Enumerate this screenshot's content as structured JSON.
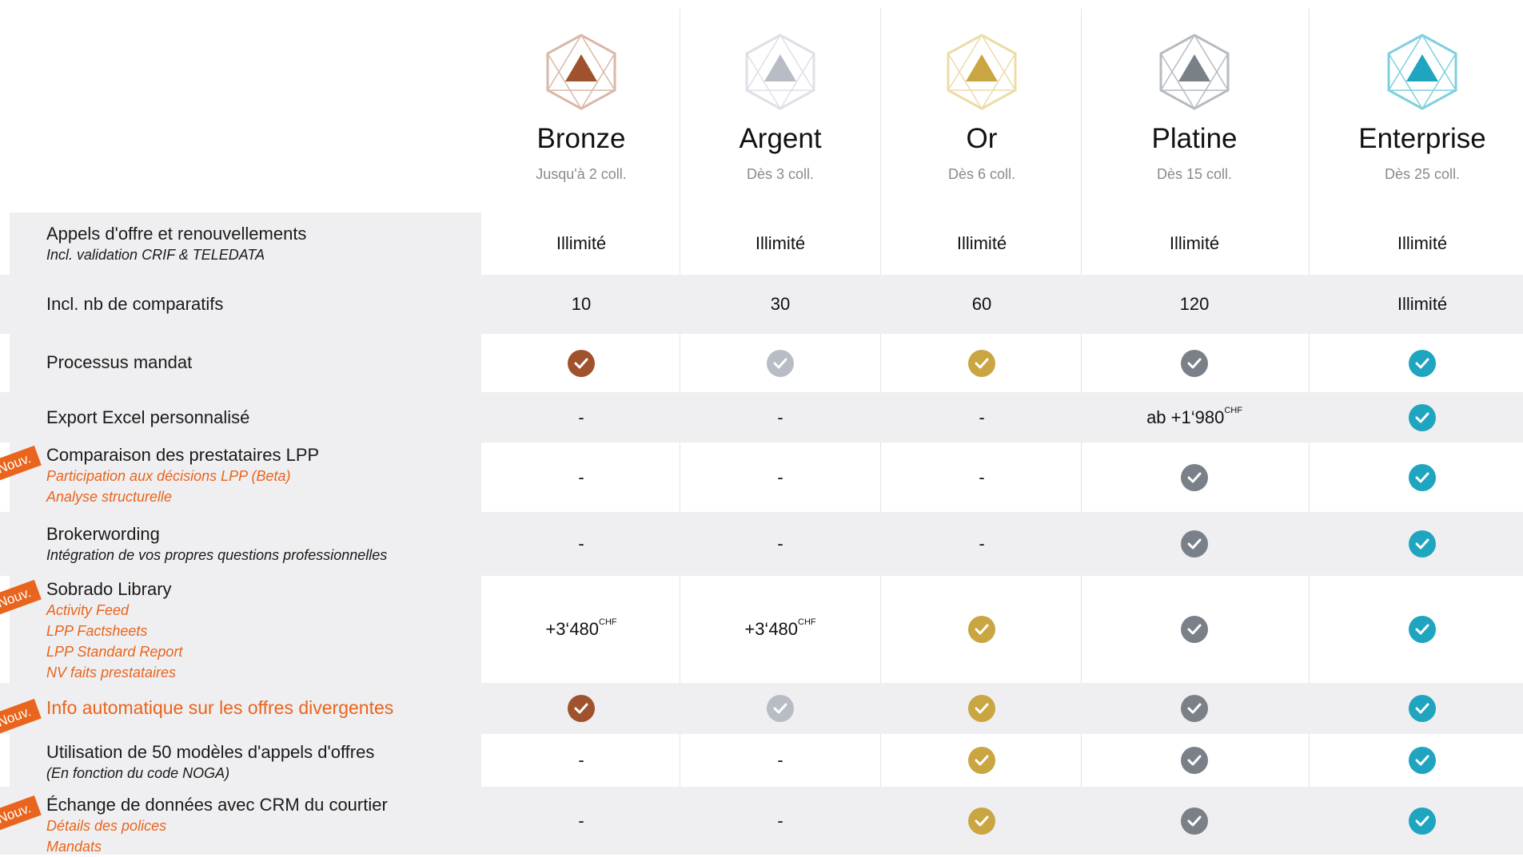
{
  "colors": {
    "bronze": "#a0522d",
    "argent": "#b8bcc4",
    "or": "#c9a642",
    "platine": "#7a8088",
    "enterprise": "#1fa5bf",
    "orange_accent": "#e9641c"
  },
  "tiers": [
    {
      "name": "Bronze",
      "subtitle": "Jusqu'à 2 coll."
    },
    {
      "name": "Argent",
      "subtitle": "Dès 3 coll."
    },
    {
      "name": "Or",
      "subtitle": "Dès 6 coll."
    },
    {
      "name": "Platine",
      "subtitle": "Dès 15 coll."
    },
    {
      "name": "Enterprise",
      "subtitle": "Dès 25 coll."
    }
  ],
  "badge_label": "Nouv.",
  "rows": [
    {
      "title": "Appels d'offre et renouvellements",
      "sub": [
        "Incl. validation CRIF & TELEDATA"
      ],
      "sub_style": "dark",
      "values": [
        {
          "text": "Illimité"
        },
        {
          "text": "Illimité"
        },
        {
          "text": "Illimité"
        },
        {
          "text": "Illimité"
        },
        {
          "text": "Illimité"
        }
      ]
    },
    {
      "title": "Incl. nb de comparatifs",
      "sub": [],
      "values": [
        {
          "text": "10"
        },
        {
          "text": "30"
        },
        {
          "text": "60"
        },
        {
          "text": "120"
        },
        {
          "text": "Illimité"
        }
      ]
    },
    {
      "title": "Processus mandat",
      "sub": [],
      "values": [
        {
          "check": true
        },
        {
          "check": true
        },
        {
          "check": true
        },
        {
          "check": true
        },
        {
          "check": true
        }
      ]
    },
    {
      "title": "Export Excel personnalisé",
      "sub": [],
      "values": [
        {
          "text": "-"
        },
        {
          "text": "-"
        },
        {
          "text": "-"
        },
        {
          "text": "ab +1‘980",
          "sup": "CHF"
        },
        {
          "check": true
        }
      ]
    },
    {
      "title": "Comparaison des prestataires LPP",
      "sub": [
        "Participation aux décisions LPP (Beta)",
        "Analyse structurelle"
      ],
      "sub_style": "orange",
      "new": true,
      "values": [
        {
          "text": "-"
        },
        {
          "text": "-"
        },
        {
          "text": "-"
        },
        {
          "check": true
        },
        {
          "check": true
        }
      ]
    },
    {
      "title": "Brokerwording",
      "sub": [
        "Intégration de vos propres questions professionnelles"
      ],
      "sub_style": "dark",
      "values": [
        {
          "text": "-"
        },
        {
          "text": "-"
        },
        {
          "text": "-"
        },
        {
          "check": true
        },
        {
          "check": true
        }
      ]
    },
    {
      "title": "Sobrado Library",
      "sub": [
        "Activity Feed",
        "LPP Factsheets",
        "LPP Standard Report",
        "NV faits prestataires"
      ],
      "sub_style": "orange",
      "new": true,
      "values": [
        {
          "text": "+3‘480",
          "sup": "CHF"
        },
        {
          "text": "+3‘480",
          "sup": "CHF"
        },
        {
          "check": true
        },
        {
          "check": true
        },
        {
          "check": true
        }
      ]
    },
    {
      "title": "Info automatique sur les offres divergentes",
      "sub": [],
      "title_orange": true,
      "new": true,
      "values": [
        {
          "check": true
        },
        {
          "check": true
        },
        {
          "check": true
        },
        {
          "check": true
        },
        {
          "check": true
        }
      ]
    },
    {
      "title": "Utilisation de 50 modèles d'appels d'offres",
      "sub": [
        "(En fonction du code NOGA)"
      ],
      "sub_style": "dark",
      "values": [
        {
          "text": "-"
        },
        {
          "text": "-"
        },
        {
          "check": true
        },
        {
          "check": true
        },
        {
          "check": true
        }
      ]
    },
    {
      "title": "Échange de données avec CRM du courtier",
      "sub": [
        "Détails des polices",
        "Mandats"
      ],
      "sub_style": "orange",
      "new": true,
      "values": [
        {
          "text": "-"
        },
        {
          "text": "-"
        },
        {
          "check": true
        },
        {
          "check": true
        },
        {
          "check": true
        }
      ]
    }
  ]
}
